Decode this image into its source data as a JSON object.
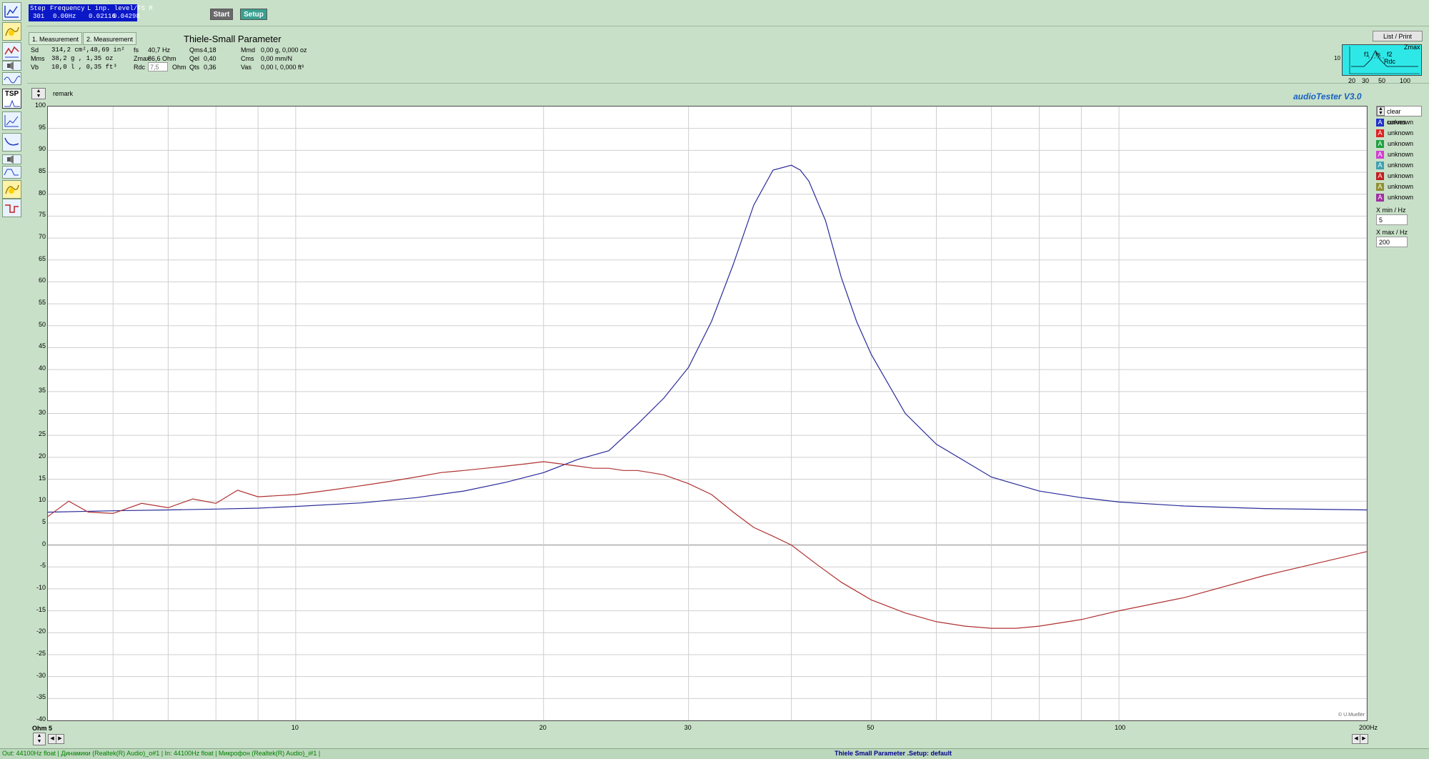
{
  "toolbar": {
    "icons": [
      "level-meter-icon",
      "sound-map-icon",
      "frequency-response-icon",
      "speaker-icon",
      "sweep-icon",
      "tsp-icon",
      "impedance-icon",
      "curve-icon",
      "speaker-box-icon",
      "waveform-icon",
      "yellow-map-icon",
      "step-response-icon"
    ],
    "tsp_label": "TSP"
  },
  "status": {
    "step_label": "Step",
    "step_value": "301",
    "frequency_label": "Frequency",
    "frequency_value": "0.00Hz",
    "level_label": "L  inp. level/FS  R",
    "level_left": "0.02116",
    "level_right": "0.04298"
  },
  "buttons": {
    "start": "Start",
    "setup": "Setup",
    "list_print": "List / Print"
  },
  "measurement_tabs": [
    "1. Measurement",
    "2. Measurement"
  ],
  "panel_title": "Thiele-Small Parameter",
  "params": {
    "sd_label": "Sd",
    "sd_value": "314,2 cm²,48,69 in²",
    "mms_label": "Mms",
    "mms_value": "38,2 g  , 1,35 oz",
    "vb_label": "Vb",
    "vb_value": "10,0 l  , 0,35 ft³",
    "fs_label": "fs",
    "fs_value": "40,7 Hz",
    "zmax_label": "Zmax",
    "zmax_value": "86,6 Ohm",
    "rdc_label": "Rdc",
    "rdc_value": "7,5",
    "rdc_unit": "Ohm",
    "qms_label": "Qms",
    "qms_value": "4,18",
    "qel_label": "Qel",
    "qel_value": "0,40",
    "qts_label": "Qts",
    "qts_value": "0,36",
    "mmd_label": "Mmd",
    "mmd_value": "0,00 g, 0,000 oz",
    "cms_label": "Cms",
    "cms_value": "0,00 mm/N",
    "vas_label": "Vas",
    "vas_value": "0,00 l, 0,000 ft³"
  },
  "mini_plot": {
    "labels": {
      "zmax": "Zmax",
      "f1": "f1",
      "fs": "fs",
      "f2": "f2",
      "rdc": "Rdc",
      "y10": "10"
    },
    "x_ticks": [
      "20",
      "30",
      "50",
      "100"
    ]
  },
  "remark": "remark",
  "brand": "audioTester  V3.0",
  "copyright": "© U.Mueller",
  "legend": {
    "clear_curves": "clear curves",
    "items": [
      {
        "letter": "A",
        "label": "unknown",
        "color": "#2030c8"
      },
      {
        "letter": "A",
        "label": "unknown",
        "color": "#e02020"
      },
      {
        "letter": "A",
        "label": "unknown",
        "color": "#20a040"
      },
      {
        "letter": "A",
        "label": "unknown",
        "color": "#d040d0"
      },
      {
        "letter": "A",
        "label": "unknown",
        "color": "#40a0b0"
      },
      {
        "letter": "A",
        "label": "unknown",
        "color": "#c02020"
      },
      {
        "letter": "A",
        "label": "unknown",
        "color": "#909030"
      },
      {
        "letter": "A",
        "label": "unknown",
        "color": "#a030a0"
      }
    ],
    "xmin_label": "X min / Hz",
    "xmin_value": "5",
    "xmax_label": "X max / Hz",
    "xmax_value": "200"
  },
  "axis": {
    "y_unit": "Ohm",
    "x_start_label": "5",
    "x_end_label": "200Hz",
    "x_tick_labels": [
      {
        "f": 10,
        "label": "10"
      },
      {
        "f": 20,
        "label": "20"
      },
      {
        "f": 30,
        "label": "30"
      },
      {
        "f": 50,
        "label": "50"
      },
      {
        "f": 100,
        "label": "100"
      }
    ]
  },
  "chart_data": {
    "type": "line",
    "x_scale": "log",
    "xlim": [
      5,
      200
    ],
    "ylim": [
      -40,
      100
    ],
    "y_ticks": [
      100,
      95,
      90,
      85,
      80,
      75,
      70,
      65,
      60,
      55,
      50,
      45,
      40,
      35,
      30,
      25,
      20,
      15,
      10,
      5,
      0,
      -5,
      -10,
      -15,
      -20,
      -25,
      -30,
      -35,
      -40
    ],
    "grid": true,
    "series": [
      {
        "color": "#2a2a9a",
        "x": [
          5,
          6,
          7,
          8,
          9,
          10,
          12,
          14,
          16,
          18,
          20,
          22,
          24,
          26,
          28,
          30,
          32,
          34,
          36,
          38,
          40,
          41,
          42,
          44,
          46,
          48,
          50,
          55,
          60,
          70,
          80,
          90,
          100,
          120,
          150,
          200
        ],
        "y": [
          7.5,
          7.8,
          8.0,
          8.2,
          8.4,
          8.8,
          9.6,
          10.8,
          12.3,
          14.3,
          16.5,
          19.5,
          21.5,
          27.5,
          33.5,
          40.5,
          51,
          64,
          77.5,
          85.5,
          86.6,
          85.5,
          83,
          74,
          61,
          51,
          43.5,
          30,
          23,
          15.5,
          12.3,
          10.8,
          9.8,
          8.9,
          8.3,
          8.0
        ]
      },
      {
        "color": "#b03030",
        "x": [
          5,
          5.3,
          5.6,
          6,
          6.5,
          7,
          7.5,
          8,
          8.5,
          9,
          10,
          11,
          12,
          13,
          14,
          15,
          16,
          17,
          18,
          19,
          20,
          21,
          22,
          23,
          24,
          25,
          26,
          27,
          28,
          30,
          32,
          34,
          36,
          38,
          40,
          43,
          46,
          50,
          55,
          60,
          65,
          70,
          75,
          80,
          90,
          100,
          120,
          150,
          200
        ],
        "y": [
          6.5,
          10,
          7.5,
          7.2,
          9.5,
          8.5,
          10.5,
          9.5,
          12.5,
          11,
          11.5,
          12.5,
          13.5,
          14.5,
          15.5,
          16.5,
          17,
          17.5,
          18,
          18.5,
          19,
          18.5,
          18,
          17.5,
          17.5,
          17,
          17,
          16.5,
          16,
          14,
          11.5,
          7.5,
          4,
          2,
          0,
          -4.5,
          -8.5,
          -12.5,
          -15.5,
          -17.5,
          -18.5,
          -19,
          -19,
          -18.5,
          -17,
          -15,
          -12,
          -7,
          -1.5
        ]
      }
    ]
  },
  "statusbar": {
    "left": "Out: 44100Hz float  | Динамики (Realtek(R) Audio)_o#1 |  In: 44100Hz float  | Микрофон (Realtek(R) Audio)_i#1 |",
    "center": "Thiele Small Parameter .Setup:  default"
  }
}
